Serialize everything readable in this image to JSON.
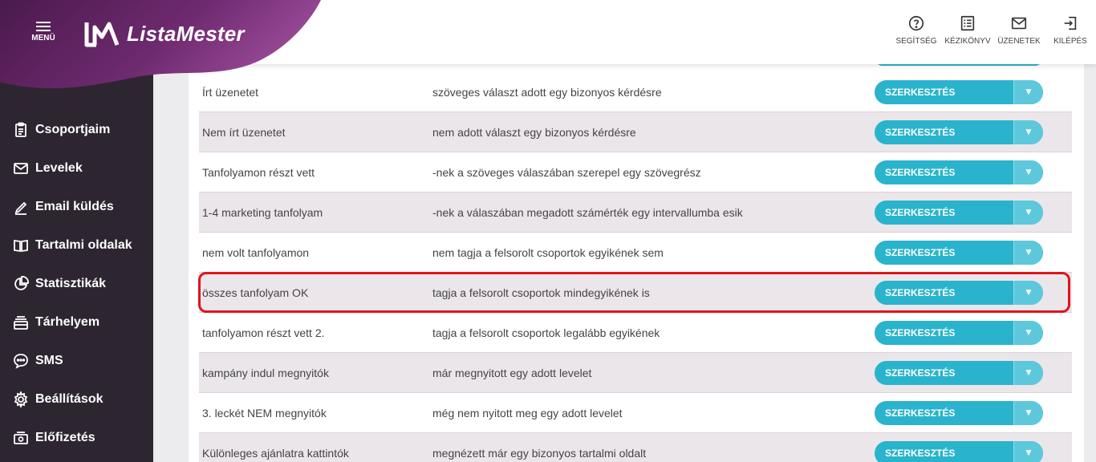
{
  "app": {
    "name": "ListaMester",
    "menu_label": "MENÜ"
  },
  "colors": {
    "brand_purple": "#5a1f5c",
    "sidebar_bg": "#2d2630",
    "button_teal": "#2ab3cc",
    "highlight_red": "#e0141b"
  },
  "top_actions": [
    {
      "label": "SEGÍTSÉG",
      "icon": "help-icon"
    },
    {
      "label": "KÉZIKÖNYV",
      "icon": "manual-icon"
    },
    {
      "label": "ÜZENETEK",
      "icon": "mail-icon"
    },
    {
      "label": "KILÉPÉS",
      "icon": "logout-icon"
    }
  ],
  "sidebar": {
    "items": [
      {
        "label": "Csoportjaim",
        "icon": "clipboard-icon"
      },
      {
        "label": "Levelek",
        "icon": "envelope-icon"
      },
      {
        "label": "Email küldés",
        "icon": "pen-icon"
      },
      {
        "label": "Tartalmi oldalak",
        "icon": "book-icon"
      },
      {
        "label": "Statisztikák",
        "icon": "pie-chart-icon"
      },
      {
        "label": "Tárhelyem",
        "icon": "storage-icon"
      },
      {
        "label": "SMS",
        "icon": "chat-icon"
      },
      {
        "label": "Beállítások",
        "icon": "gear-icon"
      },
      {
        "label": "Előfizetés",
        "icon": "subscription-icon"
      }
    ]
  },
  "table": {
    "edit_label": "SZERKESZTÉS",
    "rows": [
      {
        "name": "Írt üzenetet",
        "description": "szöveges választ adott egy bizonyos kérdésre"
      },
      {
        "name": "Nem írt üzenetet",
        "description": "nem adott választ egy bizonyos kérdésre"
      },
      {
        "name": "Tanfolyamon részt vett",
        "description": "-nek a szöveges válaszában szerepel egy szövegrész"
      },
      {
        "name": "1-4 marketing tanfolyam",
        "description": "-nek a válaszában megadott számérték egy intervallumba esik"
      },
      {
        "name": "nem volt tanfolyamon",
        "description": "nem tagja a felsorolt csoportok egyikének sem"
      },
      {
        "name": "összes tanfolyam OK",
        "description": "tagja a felsorolt csoportok mindegyikének is"
      },
      {
        "name": "tanfolyamon részt vett 2.",
        "description": "tagja a felsorolt csoportok legalább egyikének"
      },
      {
        "name": "kampány indul megnyitók",
        "description": "már megnyitott egy adott levelet"
      },
      {
        "name": "3. leckét NEM megnyitók",
        "description": "még nem nyitott meg egy adott levelet"
      },
      {
        "name": "Különleges ajánlatra kattintók",
        "description": "megnézett már egy bizonyos tartalmi oldalt"
      }
    ]
  }
}
